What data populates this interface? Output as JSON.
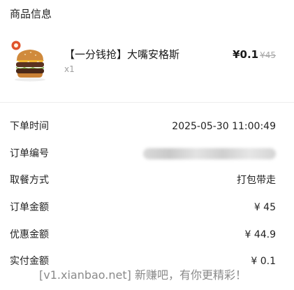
{
  "section": {
    "title": "商品信息"
  },
  "product": {
    "name": "【一分钱抢】大嘴安格斯",
    "quantity": "x1",
    "price_now": "¥0.1",
    "price_old": "¥45",
    "image_icon": "burger-icon",
    "badge_icon": "brand-badge-icon"
  },
  "order_info": [
    {
      "label": "下单时间",
      "value": "2025-05-30 11:00:49"
    },
    {
      "label": "订单编号",
      "value": ""
    },
    {
      "label": "取餐方式",
      "value": "打包带走"
    },
    {
      "label": "订单金额",
      "value": "¥ 45"
    },
    {
      "label": "优惠金额",
      "value": "¥ 44.9"
    },
    {
      "label": "实付金额",
      "value": "¥ 0.1"
    }
  ],
  "watermark": {
    "text": "[v1.xianbao.net] 新赚吧，有你更精彩！"
  },
  "colors": {
    "divider": "#ededed",
    "muted_text": "#a0a0a0",
    "badge_red": "#e0532b"
  }
}
